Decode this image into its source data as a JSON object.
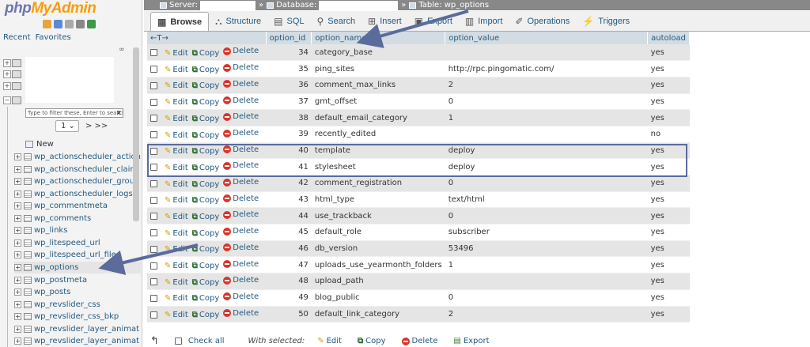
{
  "app": {
    "logo_main": "php",
    "logo_accent": "MyAdmin",
    "recent_label": "Recent",
    "favorites_label": "Favorites"
  },
  "nav": {
    "filter_placeholder": "Type to filter these, Enter to search",
    "filter_clear": "X",
    "page_select": "1",
    "page_next": "> >>",
    "new_label": "New",
    "tables": [
      "wp_actionscheduler_action",
      "wp_actionscheduler_claim",
      "wp_actionscheduler_group",
      "wp_actionscheduler_logs",
      "wp_commentmeta",
      "wp_comments",
      "wp_links",
      "wp_litespeed_url",
      "wp_litespeed_url_file",
      "wp_options",
      "wp_postmeta",
      "wp_posts",
      "wp_revslider_css",
      "wp_revslider_css_bkp",
      "wp_revslider_layer_animat",
      "wp_revslider_layer_animat"
    ],
    "active_table": "wp_options"
  },
  "breadcrumb": {
    "server_label": "Server:",
    "database_label": "Database:",
    "table_label": "Table: wp_options"
  },
  "tabs": [
    {
      "label": "Browse",
      "icon": "browse-icon",
      "active": true
    },
    {
      "label": "Structure",
      "icon": "structure-icon",
      "active": false
    },
    {
      "label": "SQL",
      "icon": "sql-icon",
      "active": false
    },
    {
      "label": "Search",
      "icon": "search-icon",
      "active": false
    },
    {
      "label": "Insert",
      "icon": "insert-icon",
      "active": false
    },
    {
      "label": "Export",
      "icon": "export-icon",
      "active": false
    },
    {
      "label": "Import",
      "icon": "import-icon",
      "active": false
    },
    {
      "label": "Operations",
      "icon": "operations-icon",
      "active": false
    },
    {
      "label": "Triggers",
      "icon": "triggers-icon",
      "active": false
    }
  ],
  "grid": {
    "sort_arrows": "←T→",
    "columns": [
      "option_id",
      "option_name",
      "option_value",
      "autoload"
    ],
    "action_labels": {
      "edit": "Edit",
      "copy": "Copy",
      "delete": "Delete"
    },
    "rows": [
      {
        "id": "34",
        "name": "category_base",
        "value": "",
        "autoload": "yes"
      },
      {
        "id": "35",
        "name": "ping_sites",
        "value": "http://rpc.pingomatic.com/",
        "autoload": "yes"
      },
      {
        "id": "36",
        "name": "comment_max_links",
        "value": "2",
        "autoload": "yes"
      },
      {
        "id": "37",
        "name": "gmt_offset",
        "value": "0",
        "autoload": "yes"
      },
      {
        "id": "38",
        "name": "default_email_category",
        "value": "1",
        "autoload": "yes"
      },
      {
        "id": "39",
        "name": "recently_edited",
        "value": "",
        "autoload": "no"
      },
      {
        "id": "40",
        "name": "template",
        "value": "deploy",
        "autoload": "yes"
      },
      {
        "id": "41",
        "name": "stylesheet",
        "value": "deploy",
        "autoload": "yes"
      },
      {
        "id": "42",
        "name": "comment_registration",
        "value": "0",
        "autoload": "yes"
      },
      {
        "id": "43",
        "name": "html_type",
        "value": "text/html",
        "autoload": "yes"
      },
      {
        "id": "44",
        "name": "use_trackback",
        "value": "0",
        "autoload": "yes"
      },
      {
        "id": "45",
        "name": "default_role",
        "value": "subscriber",
        "autoload": "yes"
      },
      {
        "id": "46",
        "name": "db_version",
        "value": "53496",
        "autoload": "yes"
      },
      {
        "id": "47",
        "name": "uploads_use_yearmonth_folders",
        "value": "1",
        "autoload": "yes"
      },
      {
        "id": "48",
        "name": "upload_path",
        "value": "",
        "autoload": "yes"
      },
      {
        "id": "49",
        "name": "blog_public",
        "value": "0",
        "autoload": "yes"
      },
      {
        "id": "50",
        "name": "default_link_category",
        "value": "2",
        "autoload": "yes"
      }
    ]
  },
  "footer": {
    "check_all": "Check all",
    "with_selected": "With selected:",
    "edit": "Edit",
    "copy": "Copy",
    "delete": "Delete",
    "export": "Export"
  },
  "colors": {
    "link": "#235a81",
    "annotation": "#5b6b9c",
    "header_bg": "#d3dce3"
  }
}
